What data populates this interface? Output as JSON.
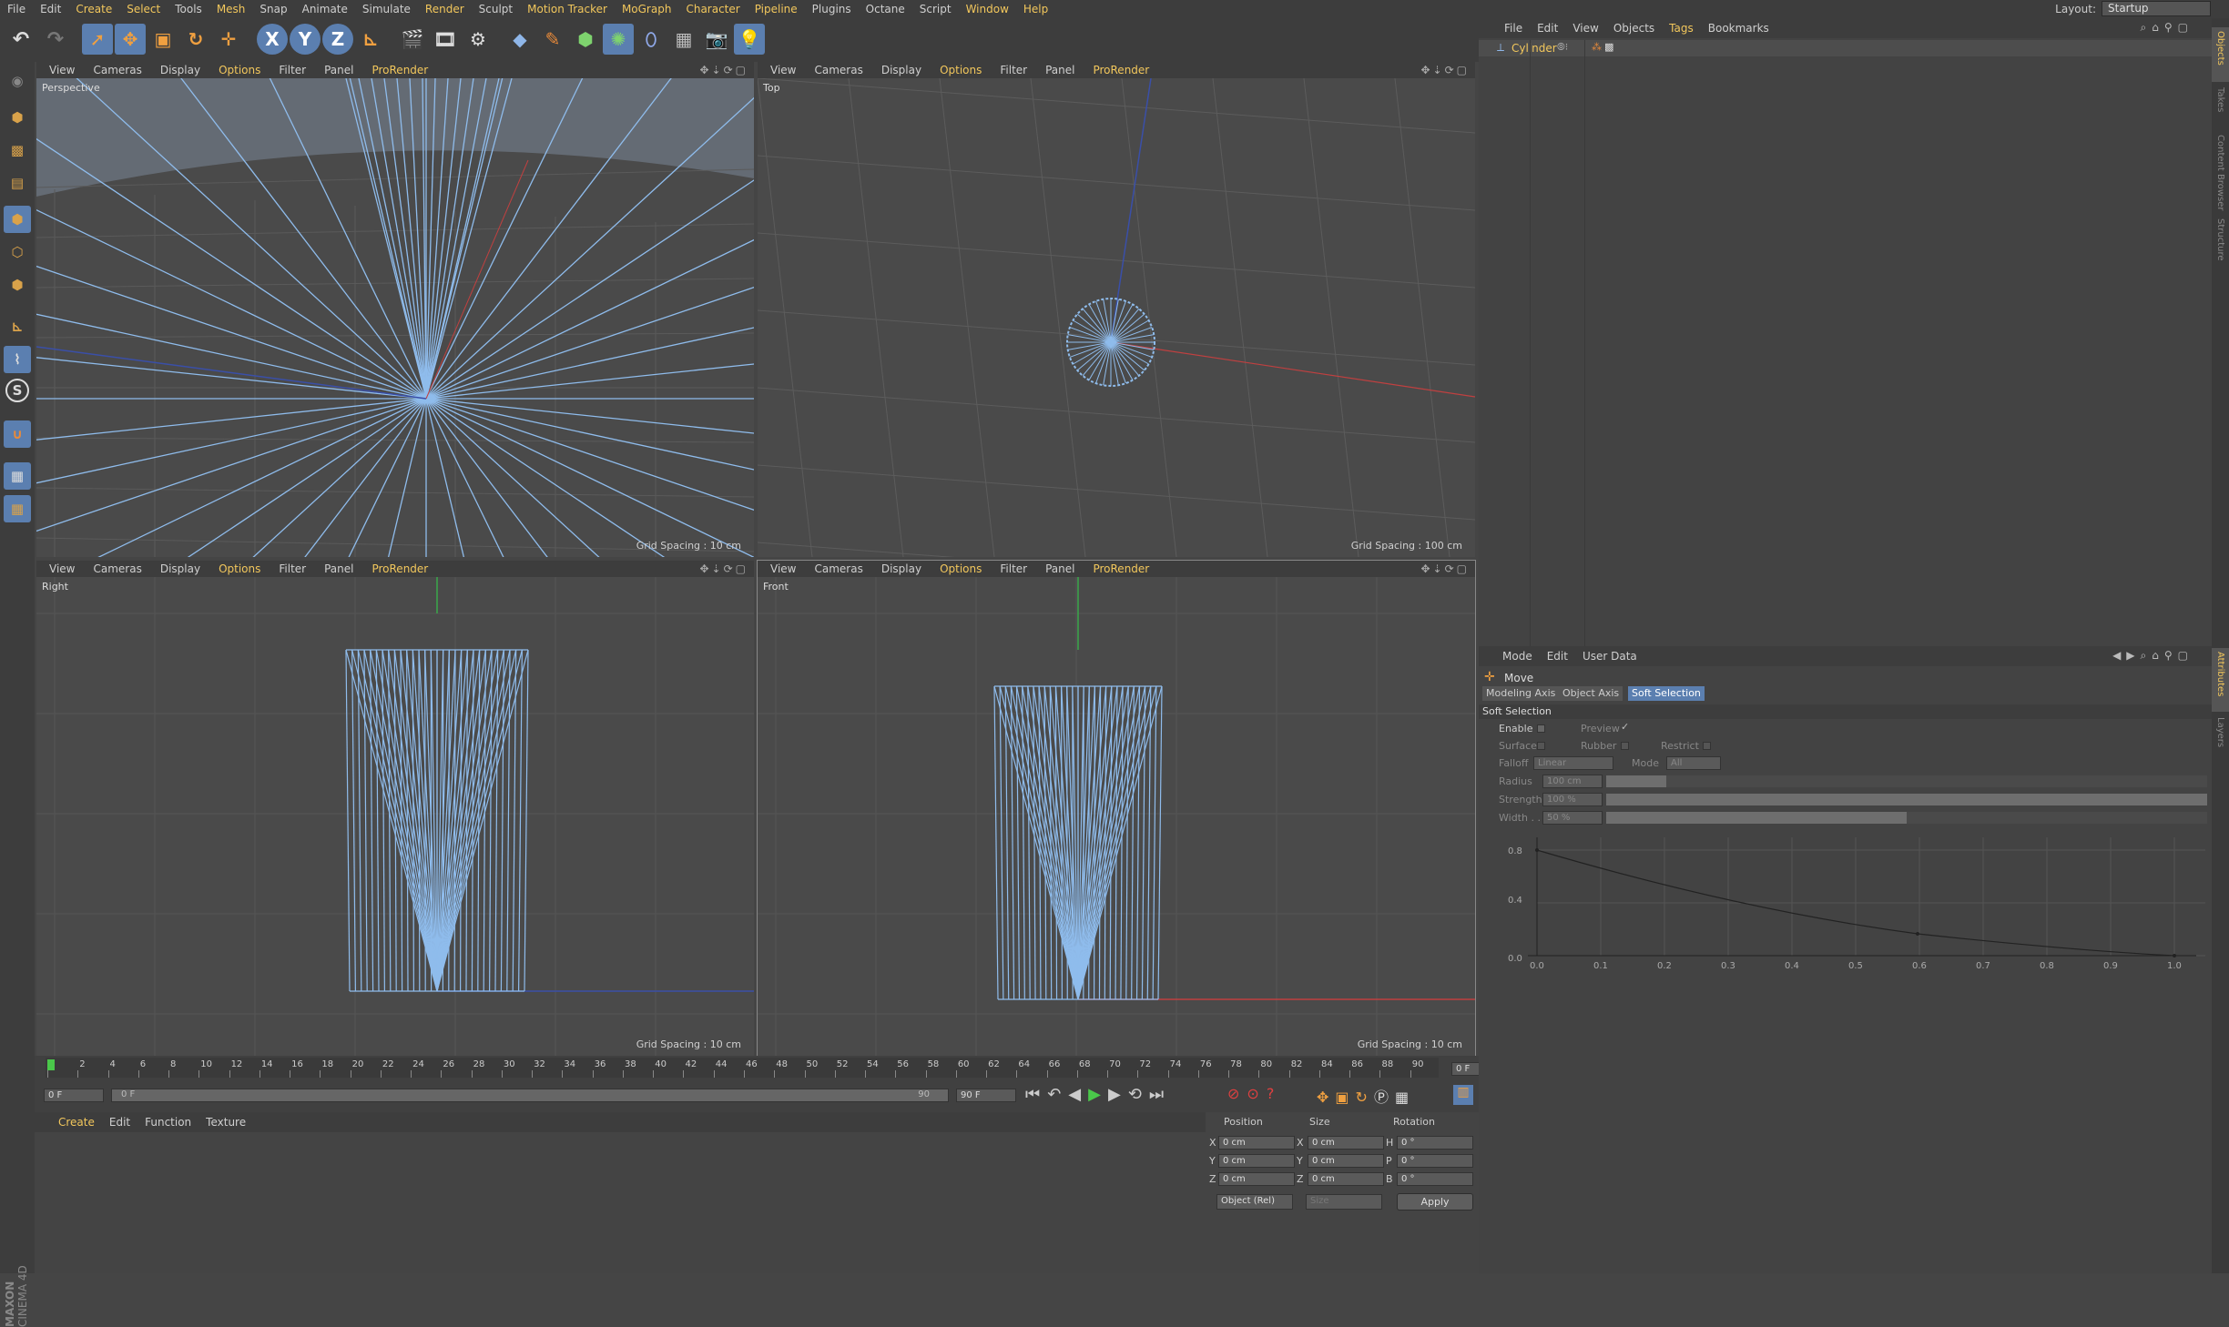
{
  "menubar": {
    "items": [
      "File",
      "Edit",
      "Create",
      "Select",
      "Tools",
      "Mesh",
      "Snap",
      "Animate",
      "Simulate",
      "Render",
      "Sculpt",
      "Motion Tracker",
      "MoGraph",
      "Character",
      "Pipeline",
      "Plugins",
      "Octane",
      "Script",
      "Window",
      "Help"
    ],
    "layout_label": "Layout:",
    "layout_value": "Startup"
  },
  "viewport_menu": [
    "View",
    "Cameras",
    "Display",
    "Options",
    "Filter",
    "Panel",
    "ProRender"
  ],
  "viewports": [
    {
      "name": "Perspective",
      "grid": "Grid Spacing : 10 cm"
    },
    {
      "name": "Top",
      "grid": "Grid Spacing : 100 cm"
    },
    {
      "name": "Right",
      "grid": "Grid Spacing : 10 cm"
    },
    {
      "name": "Front",
      "grid": "Grid Spacing : 10 cm"
    }
  ],
  "toolbar": {
    "x": "X",
    "y": "Y",
    "z": "Z"
  },
  "lefttools": {
    "s": "S"
  },
  "timeline": {
    "ticks": [
      "0",
      "2",
      "4",
      "6",
      "8",
      "10",
      "12",
      "14",
      "16",
      "18",
      "20",
      "22",
      "24",
      "26",
      "28",
      "30",
      "32",
      "34",
      "36",
      "38",
      "40",
      "42",
      "44",
      "46",
      "48",
      "50",
      "52",
      "54",
      "56",
      "58",
      "60",
      "62",
      "64",
      "66",
      "68",
      "70",
      "72",
      "74",
      "76",
      "78",
      "80",
      "82",
      "84",
      "86",
      "88",
      "90"
    ],
    "current_frame": "0 F",
    "start": "0 F",
    "slider_start": "0 F",
    "slider_end": "90 F",
    "slider_end_num": "90",
    "end": "90 F"
  },
  "material_manager": {
    "menu": [
      "Create",
      "Edit",
      "Function",
      "Texture"
    ]
  },
  "coords": {
    "headers": [
      "Position",
      "Size",
      "Rotation"
    ],
    "rows": [
      {
        "axis": "X",
        "pos": "0 cm",
        "saxis": "X",
        "size": "0 cm",
        "raxis": "H",
        "rot": "0 °"
      },
      {
        "axis": "Y",
        "pos": "0 cm",
        "saxis": "Y",
        "size": "0 cm",
        "raxis": "P",
        "rot": "0 °"
      },
      {
        "axis": "Z",
        "pos": "0 cm",
        "saxis": "Z",
        "size": "0 cm",
        "raxis": "B",
        "rot": "0 °"
      }
    ],
    "mode": "Object (Rel)",
    "size_mode": "Size",
    "apply": "Apply"
  },
  "object_manager": {
    "menu": [
      "File",
      "Edit",
      "View",
      "Objects",
      "Tags",
      "Bookmarks"
    ],
    "objects": [
      {
        "name": "Cylinder"
      }
    ]
  },
  "attributes": {
    "menu": [
      "Mode",
      "Edit",
      "User Data"
    ],
    "tool": "Move",
    "tabs": [
      "Modeling Axis",
      "Object Axis",
      "Soft Selection"
    ],
    "section": "Soft Selection",
    "enable": "Enable",
    "preview": "Preview",
    "surface": "Surface",
    "rubber": "Rubber",
    "restrict": "Restrict",
    "falloff_label": "Falloff",
    "falloff_value": "Linear",
    "mode_label": "Mode",
    "mode_value": "All",
    "radius_label": "Radius",
    "radius_value": "100 cm",
    "strength_label": "Strength",
    "strength_value": "100 %",
    "width_label": "Width . .",
    "width_value": "50 %",
    "curve_y": [
      "0.8",
      "0.4",
      "0.0"
    ],
    "curve_x": [
      "0.0",
      "0.1",
      "0.2",
      "0.3",
      "0.4",
      "0.5",
      "0.6",
      "0.7",
      "0.8",
      "0.9",
      "1.0"
    ]
  },
  "sidetabs": [
    "Objects",
    "Takes",
    "Content Browser",
    "Structure",
    "Attributes",
    "Layers"
  ],
  "brand": {
    "line1": "MAXON",
    "line2": "CINEMA 4D"
  },
  "colors": {
    "accent": "#f2c75c",
    "wire": "#7fb0e0",
    "active_tab": "#5b7fb0"
  }
}
